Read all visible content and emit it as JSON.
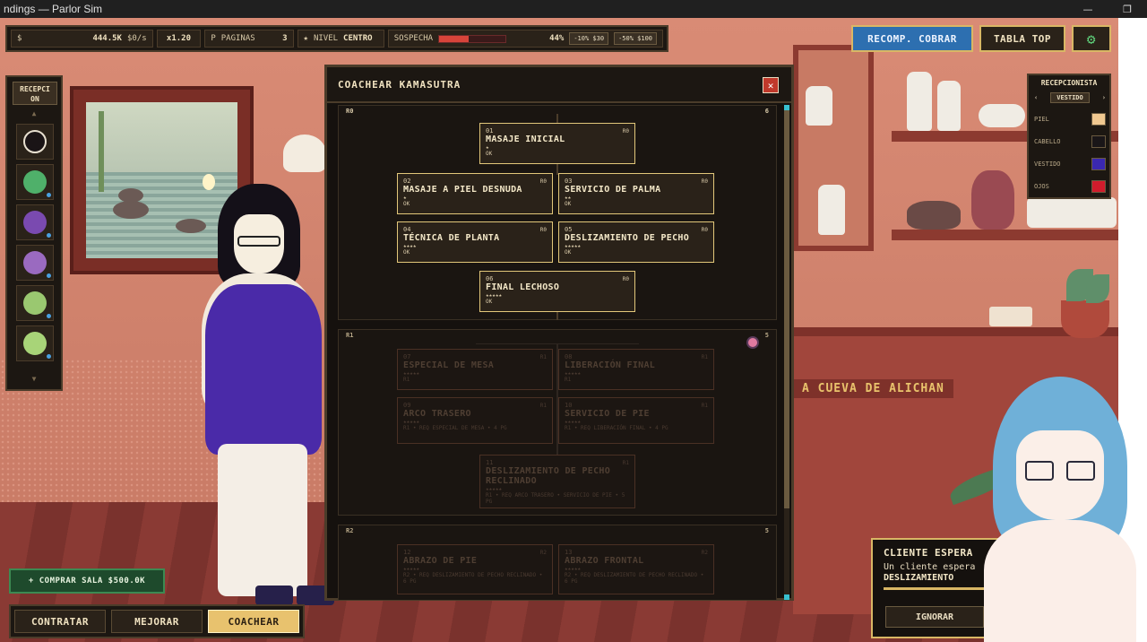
{
  "window": {
    "title": "ndings — Parlor Sim",
    "min_icon": "minimize-glyph",
    "max_icon": "maximize-glyph"
  },
  "hud": {
    "money_icon": "$",
    "money": "444.5K",
    "money_rate": "$0/s",
    "multiplier": "x1.20",
    "pages_icon": "P",
    "pages_label": "PAGINAS",
    "pages_value": "3",
    "level_icon": "★",
    "level_label": "NIVEL",
    "level_value": "CENTRO",
    "suspicion_label": "SOSPECHA",
    "suspicion_value": "44%",
    "suspicion_fraction": 0.44,
    "btn_reduce_small": "-10% $30",
    "btn_reduce_large": "-50% $100"
  },
  "top_buttons": {
    "recomp": "RECOMP. COBRAR",
    "tabla": "TABLA TOP",
    "settings_icon": "⚙"
  },
  "roster": {
    "label": "RECEPCI ON",
    "up": "▲",
    "down": "▼"
  },
  "recepcionista": {
    "title": "RECEPCIONISTA",
    "prev": "‹",
    "next": "›",
    "selected": "VESTIDO",
    "rows": [
      {
        "label": "PIEL",
        "color": "#f0c890"
      },
      {
        "label": "CABELLO",
        "color": "#1a1618"
      },
      {
        "label": "VESTIDO",
        "color": "#3a28b0"
      },
      {
        "label": "OJOS",
        "color": "#d01c2c"
      }
    ]
  },
  "modal": {
    "title": "COACHEAR KAMASUTRA",
    "close": "✕",
    "tiers": [
      {
        "name": "R0",
        "count": "6"
      },
      {
        "name": "R1",
        "count": "5"
      },
      {
        "name": "R2",
        "count": "5"
      }
    ],
    "nodes_r0": [
      {
        "num": "01",
        "rank": "R0",
        "name": "MASAJE INICIAL",
        "stars": "★",
        "status": "OK"
      },
      {
        "num": "02",
        "rank": "R0",
        "name": "MASAJE A PIEL DESNUDA",
        "stars": "★",
        "status": "OK"
      },
      {
        "num": "03",
        "rank": "R0",
        "name": "SERVICIO DE PALMA",
        "stars": "★★",
        "status": "OK"
      },
      {
        "num": "04",
        "rank": "R0",
        "name": "TÉCNICA DE PLANTA",
        "stars": "★★★★",
        "status": "OK"
      },
      {
        "num": "05",
        "rank": "R0",
        "name": "DESLIZAMIENTO DE PECHO",
        "stars": "★★★★★",
        "status": "OK"
      },
      {
        "num": "06",
        "rank": "R0",
        "name": "FINAL LECHOSO",
        "stars": "★★★★★",
        "status": "OK"
      }
    ],
    "nodes_r1": [
      {
        "num": "07",
        "rank": "R1",
        "name": "ESPECIAL DE MESA",
        "stars": "★★★★★",
        "status": "R1"
      },
      {
        "num": "08",
        "rank": "R1",
        "name": "LIBERACIÓN FINAL",
        "stars": "★★★★★",
        "status": "R1"
      },
      {
        "num": "09",
        "rank": "R1",
        "name": "ARCO TRASERO",
        "stars": "★★★★★",
        "status": "R1 • REQ ESPECIAL DE MESA • 4 PG"
      },
      {
        "num": "10",
        "rank": "R1",
        "name": "SERVICIO DE PIE",
        "stars": "★★★★★",
        "status": "R1 • REQ LIBERACIÓN FINAL • 4 PG"
      },
      {
        "num": "11",
        "rank": "R1",
        "name": "DESLIZAMIENTO DE PECHO RECLINADO",
        "stars": "★★★★★",
        "status": "R1 • REQ ARCO TRASERO • SERVICIO DE PIE • 5 PG"
      }
    ],
    "nodes_r2": [
      {
        "num": "12",
        "rank": "R2",
        "name": "ABRAZO DE PIE",
        "stars": "★★★★★",
        "status": "R2 • REQ DESLIZAMIENTO DE PECHO RECLINADO • 6 PG"
      },
      {
        "num": "13",
        "rank": "R2",
        "name": "ABRAZO FRONTAL",
        "stars": "★★★★★",
        "status": "R2 • REQ DESLIZAMIENTO DE PECHO RECLINADO • 6 PG"
      }
    ]
  },
  "scene": {
    "sign": "A CUEVA DE ALICHAN"
  },
  "bottom": {
    "buy_room": "+ COMPRAR SALA $500.0K",
    "contratar": "CONTRATAR",
    "mejorar": "MEJORAR",
    "coachear": "COACHEAR"
  },
  "client": {
    "title": "CLIENTE ESPERA",
    "line1": "Un cliente espera",
    "line2": "DESLIZAMIENTO",
    "ignore": "IGNORAR"
  }
}
